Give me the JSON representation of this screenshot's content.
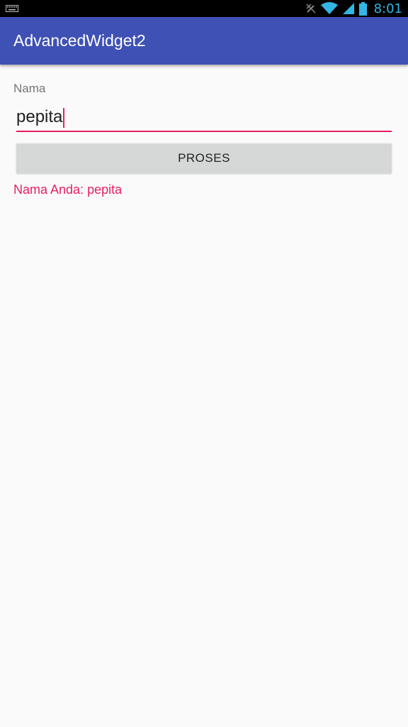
{
  "status_bar": {
    "time": "8:01",
    "icons": [
      "keyboard-icon",
      "no-signal-icon",
      "wifi-icon",
      "cell-signal-icon",
      "battery-icon"
    ]
  },
  "app_bar": {
    "title": "AdvancedWidget2",
    "color": "#3f51b5"
  },
  "form": {
    "label": "Nama",
    "input_value": "pepita",
    "button_label": "PROSES",
    "result": "Nama Anda: pepita",
    "accent_color": "#e91e63"
  }
}
